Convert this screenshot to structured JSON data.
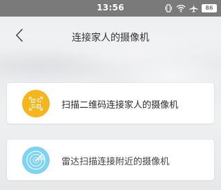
{
  "status_bar": {
    "time": "13:56",
    "battery": "86"
  },
  "nav": {
    "title": "连接家人的摄像机",
    "back_icon": "chevron-left-icon"
  },
  "options": [
    {
      "icon": "qr-code-icon",
      "icon_color": "#f5b51f",
      "label": "扫描二维码连接家人的摄像机"
    },
    {
      "icon": "radar-icon",
      "icon_color": "#7fd2f2",
      "label": "雷达扫描连接附近的摄像机"
    }
  ]
}
